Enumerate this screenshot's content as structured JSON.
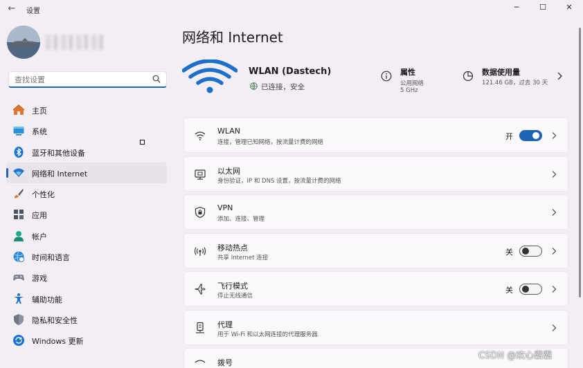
{
  "app": {
    "title": "设置",
    "back_label": "←",
    "minimize_label": "─",
    "maximize_label": "☐",
    "close_label": "✕"
  },
  "search": {
    "placeholder": "查找设置"
  },
  "sidebar": {
    "items": [
      {
        "label": "主页",
        "icon": "home-icon"
      },
      {
        "label": "系统",
        "icon": "monitor-icon"
      },
      {
        "label": "蓝牙和其他设备",
        "icon": "bluetooth-icon"
      },
      {
        "label": "网络和 Internet",
        "icon": "wifi-icon",
        "active": true
      },
      {
        "label": "个性化",
        "icon": "paintbrush-icon"
      },
      {
        "label": "应用",
        "icon": "apps-icon"
      },
      {
        "label": "帐户",
        "icon": "account-icon"
      },
      {
        "label": "时间和语言",
        "icon": "globe-clock-icon"
      },
      {
        "label": "游戏",
        "icon": "gamepad-icon"
      },
      {
        "label": "辅助功能",
        "icon": "accessibility-icon"
      },
      {
        "label": "隐私和安全性",
        "icon": "shield-icon"
      },
      {
        "label": "Windows 更新",
        "icon": "update-icon"
      }
    ]
  },
  "main": {
    "title": "网络和 Internet",
    "connection": {
      "name": "WLAN (Dastech)",
      "status": "已连接，安全",
      "properties_title": "属性",
      "properties_line1": "公用网络",
      "properties_line2": "5 GHz",
      "usage_title": "数据使用量",
      "usage_value": "121.46 GB，过去 30 天"
    },
    "cards": [
      {
        "title": "WLAN",
        "desc": "连接，管理已知网络，按流量计费的网络",
        "icon": "wifi-icon",
        "toggle_label": "开",
        "toggle_on": true
      },
      {
        "title": "以太网",
        "desc": "身份验证，IP 和 DNS 设置，按流量计费的网络",
        "icon": "ethernet-icon"
      },
      {
        "title": "VPN",
        "desc": "添加、连接、管理",
        "icon": "vpn-shield-icon"
      },
      {
        "title": "移动热点",
        "desc": "共享 Internet 连接",
        "icon": "hotspot-icon",
        "toggle_label": "关",
        "toggle_on": false
      },
      {
        "title": "飞行模式",
        "desc": "停止无线通信",
        "icon": "airplane-icon",
        "toggle_label": "关",
        "toggle_on": false
      },
      {
        "title": "代理",
        "desc": "用于 Wi-Fi 和以太网连接的代理服务器",
        "icon": "proxy-icon"
      },
      {
        "title": "拨号",
        "icon": "dialup-icon"
      }
    ]
  },
  "watermark": "CSDN @欢心霸霸"
}
